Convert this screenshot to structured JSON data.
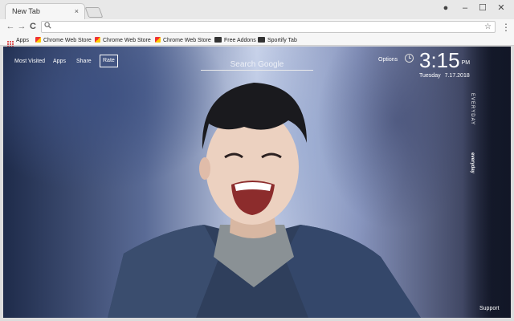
{
  "tab": {
    "title": "New Tab",
    "close": "×"
  },
  "window_controls": {
    "account": "●",
    "minimize": "–",
    "maximize": "☐",
    "close": "✕"
  },
  "toolbar": {
    "back": "←",
    "forward": "→",
    "reload": "C",
    "star": "☆",
    "menu": "⋮",
    "address_value": "",
    "search_glyph": "🔍"
  },
  "bookmarks": [
    {
      "label": "Apps",
      "icon": "apps-grid-icon"
    },
    {
      "label": "Chrome Web Store",
      "icon": "chrome-web-store-icon"
    },
    {
      "label": "Chrome Web Store",
      "icon": "chrome-web-store-icon"
    },
    {
      "label": "Chrome Web Store",
      "icon": "chrome-web-store-icon"
    },
    {
      "label": "Free Addons",
      "icon": "free-addons-icon"
    },
    {
      "label": "Sportify Tab",
      "icon": "sportify-tab-icon"
    }
  ],
  "content": {
    "nav": {
      "most_visited": "Most Visited",
      "apps": "Apps",
      "share": "Share",
      "rate": "Rate"
    },
    "search_placeholder": "Search Google",
    "options": "Options",
    "clock": {
      "time": "3:15",
      "ampm": "PM",
      "day": "Tuesday",
      "date": "7.17.2018"
    },
    "vertical_text": {
      "line1": "EVERYDAY",
      "line2": "everyday"
    },
    "support": "Support"
  }
}
